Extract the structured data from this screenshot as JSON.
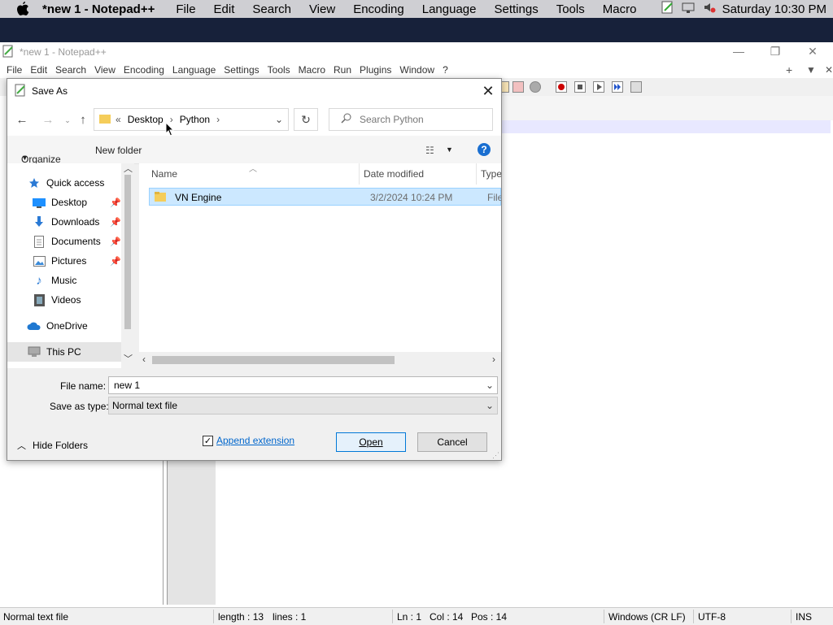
{
  "macbar": {
    "app_name": "*new 1 - Notepad++",
    "menus": [
      "File",
      "Edit",
      "Search",
      "View",
      "Encoding",
      "Language",
      "Settings",
      "Tools",
      "Macro"
    ],
    "clock": "Saturday 10:30 PM"
  },
  "npp": {
    "title": "*new 1 - Notepad++",
    "menus": [
      "File",
      "Edit",
      "Search",
      "View",
      "Encoding",
      "Language",
      "Settings",
      "Tools",
      "Macro",
      "Run",
      "Plugins",
      "Window",
      "?"
    ],
    "status": {
      "type": "Normal text file",
      "length": "length : 13",
      "lines": "lines : 1",
      "ln": "Ln : 1",
      "col": "Col : 14",
      "pos": "Pos : 14",
      "eol": "Windows (CR LF)",
      "encoding": "UTF-8",
      "mode": "INS"
    }
  },
  "dialog": {
    "title": "Save As",
    "breadcrumb": {
      "prefix": "«",
      "parts": [
        "Desktop",
        "Python"
      ]
    },
    "search_placeholder": "Search Python",
    "organize": "Organize",
    "new_folder": "New folder",
    "nav_items": [
      {
        "label": "Quick access",
        "icon": "star-icon"
      },
      {
        "label": "Desktop",
        "icon": "desktop-icon",
        "pinned": true
      },
      {
        "label": "Downloads",
        "icon": "download-icon",
        "pinned": true
      },
      {
        "label": "Documents",
        "icon": "document-icon",
        "pinned": true
      },
      {
        "label": "Pictures",
        "icon": "pictures-icon",
        "pinned": true
      },
      {
        "label": "Music",
        "icon": "music-icon"
      },
      {
        "label": "Videos",
        "icon": "video-icon"
      },
      {
        "label": "OneDrive",
        "icon": "cloud-icon"
      },
      {
        "label": "This PC",
        "icon": "computer-icon"
      }
    ],
    "columns": [
      "Name",
      "Date modified",
      "Type"
    ],
    "files": [
      {
        "name": "VN Engine",
        "modified": "3/2/2024 10:24 PM",
        "type": "File fo"
      }
    ],
    "file_name_label": "File name:",
    "file_name_value": "new 1",
    "save_type_label": "Save as type:",
    "save_type_value": "Normal text file",
    "hide_folders": "Hide Folders",
    "append_extension": "Append extension",
    "append_checked": true,
    "open_button": "Open",
    "cancel_button": "Cancel"
  },
  "colors": {
    "selection": "#cce8ff",
    "link": "#0066cc",
    "help": "#1a6fd1"
  }
}
